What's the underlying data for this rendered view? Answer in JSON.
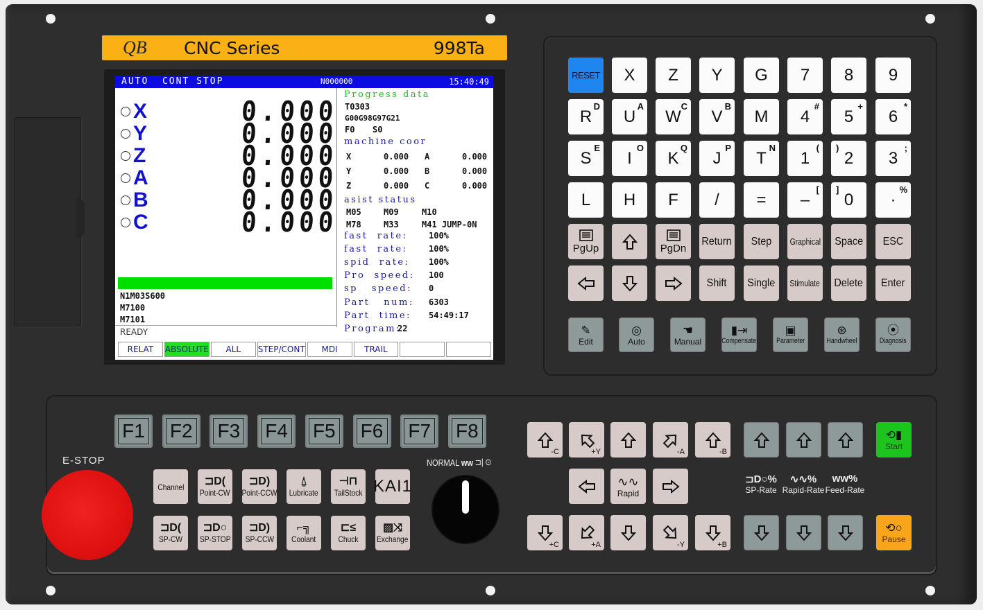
{
  "header": {
    "logo": "QB",
    "title": "CNC Series",
    "model": "998Ta"
  },
  "lcd": {
    "status": {
      "mode": "AUTO  CONT STOP",
      "block": "N000000",
      "time": "15:40:49"
    },
    "axes": [
      {
        "label": "X",
        "value": "0.000"
      },
      {
        "label": "Y",
        "value": "0.000"
      },
      {
        "label": "Z",
        "value": "0.000"
      },
      {
        "label": "A",
        "value": "0.000"
      },
      {
        "label": "B",
        "value": "0.000"
      },
      {
        "label": "C",
        "value": "0.000"
      }
    ],
    "program_lines": [
      "N1M03S600",
      "M7100",
      "M7101"
    ],
    "message": "READY",
    "progress": {
      "heading": "Progress data",
      "tool": "T0303",
      "gcodes": "G00G98G97G21",
      "feed": "F0",
      "spindle": "S0"
    },
    "machine_coor": {
      "heading": "machine coor",
      "rows": [
        {
          "a1": "X",
          "v1": "0.000",
          "a2": "A",
          "v2": "0.000"
        },
        {
          "a1": "Y",
          "v1": "0.000",
          "a2": "B",
          "v2": "0.000"
        },
        {
          "a1": "Z",
          "v1": "0.000",
          "a2": "C",
          "v2": "0.000"
        }
      ]
    },
    "assist": {
      "heading": "asist status",
      "row1": [
        "M05",
        "M09",
        "M10"
      ],
      "row2": [
        "M78",
        "M33",
        "M41 JUMP-0N"
      ]
    },
    "params": [
      {
        "label": "fast  rate:",
        "value": "100%"
      },
      {
        "label": "fast  rate:",
        "value": "100%"
      },
      {
        "label": "spid  rate:",
        "value": "100%"
      },
      {
        "label": "Pro  speed:",
        "value": "100"
      },
      {
        "label": "sp   speed:",
        "value": "0"
      },
      {
        "label": "Part   num:",
        "value": "6303"
      },
      {
        "label": "Part  time:",
        "value": "54:49:17"
      },
      {
        "label": "Program:",
        "value": "22"
      }
    ],
    "softkeys": [
      "RELAT",
      "ABSOLUTE",
      "ALL",
      "STEP/CONT",
      "MDI",
      "TRAIL",
      "",
      ""
    ],
    "active_softkey": "ABSOLUTE"
  },
  "keypad": {
    "rows": [
      [
        {
          "main": "RESET"
        },
        {
          "main": "X"
        },
        {
          "main": "Z"
        },
        {
          "main": "Y"
        },
        {
          "main": "G"
        },
        {
          "main": "7"
        },
        {
          "main": "8"
        },
        {
          "main": "9"
        }
      ],
      [
        {
          "main": "R",
          "alt": "D"
        },
        {
          "main": "U",
          "alt": "A"
        },
        {
          "main": "W",
          "alt": "C"
        },
        {
          "main": "V",
          "alt": "B"
        },
        {
          "main": "M"
        },
        {
          "main": "4",
          "alt": "#"
        },
        {
          "main": "5",
          "alt": "+"
        },
        {
          "main": "6",
          "alt": "*"
        }
      ],
      [
        {
          "main": "S",
          "alt": "E"
        },
        {
          "main": "I",
          "alt": "O"
        },
        {
          "main": "K",
          "alt": "Q"
        },
        {
          "main": "J",
          "alt": "P"
        },
        {
          "main": "T",
          "alt": "N"
        },
        {
          "main": "1",
          "alt": "("
        },
        {
          "main": "2",
          "alt": ")"
        },
        {
          "main": "3",
          "alt": ";"
        }
      ],
      [
        {
          "main": "L"
        },
        {
          "main": "H"
        },
        {
          "main": "F"
        },
        {
          "main": "/"
        },
        {
          "main": "="
        },
        {
          "main": "–",
          "alt": "["
        },
        {
          "main": "0",
          "alt": "]"
        },
        {
          "main": "·",
          "alt": "%"
        }
      ]
    ],
    "func_row1": [
      "PgUp",
      "up-arrow",
      "PgDn",
      "Return",
      "Step",
      "Graphical",
      "Space",
      "ESC"
    ],
    "func_row2": [
      "left-arrow",
      "down-arrow",
      "right-arrow",
      "Shift",
      "Single",
      "Stimulate",
      "Delete",
      "Enter"
    ],
    "modes": [
      "Edit",
      "Auto",
      "Manual",
      "Compensate",
      "Parameter",
      "Handwheel",
      "Diagnosis"
    ]
  },
  "fkeys": [
    "F1",
    "F2",
    "F3",
    "F4",
    "F5",
    "F6",
    "F7",
    "F8"
  ],
  "estop_label": "E-STOP",
  "knob_label": "NORMAL",
  "machine_keys": {
    "row1": [
      "Channel",
      "Point-CW",
      "Point-CCW",
      "Lubricate",
      "TailStock",
      "KAI1"
    ],
    "row2": [
      "SP-CW",
      "SP-STOP",
      "SP-CCW",
      "Coolant",
      "Chuck",
      "Exchange"
    ]
  },
  "jog": {
    "top": [
      "-C",
      "+Y",
      "",
      "-A",
      "-B"
    ],
    "rapid": "Rapid",
    "bottom": [
      "+C",
      "+A",
      "",
      "-Y",
      "+B"
    ]
  },
  "rates": [
    {
      "icon": "⊐D○%",
      "label": "SP-Rate"
    },
    {
      "icon": "∿∿%",
      "label": "Rapid-Rate"
    },
    {
      "icon": "ᴡᴡ%",
      "label": "Feed-Rate"
    }
  ],
  "cycle": {
    "start": "Start",
    "pause": "Pause"
  },
  "colors": {
    "title_bar": "#fbb116",
    "reset": "#1f86f0",
    "start": "#1ec41e",
    "pause": "#f9a51b",
    "estop": "#e01111",
    "lcd_status": "#0c0ce0",
    "active_softkey": "#22dd22"
  }
}
